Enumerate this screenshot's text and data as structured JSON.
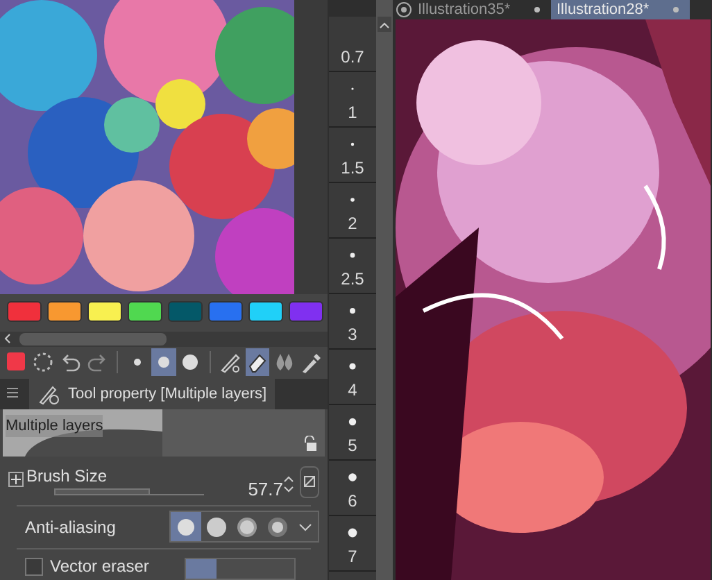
{
  "palette": {
    "swatches": [
      {
        "color": "#f0303c"
      },
      {
        "color": "#f89830"
      },
      {
        "color": "#f8f050"
      },
      {
        "color": "#50d850"
      },
      {
        "color": "#045868"
      },
      {
        "color": "#2870f0"
      },
      {
        "color": "#20d0f8"
      },
      {
        "color": "#8030f0"
      }
    ]
  },
  "toolbar": [
    {
      "kind": "color",
      "color": "#f03848",
      "selected": false
    },
    {
      "kind": "transparent",
      "selected": false
    },
    {
      "kind": "undo",
      "selected": false
    },
    {
      "kind": "redo",
      "selected": false
    },
    {
      "kind": "dot-small",
      "selected": false
    },
    {
      "kind": "dot-medium",
      "selected": true
    },
    {
      "kind": "dot-large",
      "selected": false
    },
    {
      "kind": "pen",
      "selected": false
    },
    {
      "kind": "eraser",
      "selected": true
    },
    {
      "kind": "drops",
      "selected": false
    },
    {
      "kind": "eyedropper",
      "selected": false
    }
  ],
  "tool_property": {
    "tab": "Tool property [Multiple layers]",
    "preset": "Multiple layers",
    "brush_size": {
      "label": "Brush Size",
      "value": "57.7",
      "level": 0.64
    },
    "anti_aliasing": {
      "label": "Anti-aliasing",
      "options": [
        {
          "selected": true
        },
        {
          "selected": false
        },
        {
          "selected": false
        },
        {
          "selected": false
        }
      ]
    },
    "vector_eraser": {
      "label": "Vector eraser",
      "checked": false
    }
  },
  "brush_sizes": [
    "0.7",
    "1",
    "1.5",
    "2",
    "2.5",
    "3",
    "4",
    "5",
    "6",
    "7"
  ],
  "tabs": [
    {
      "label": "Illustration35*",
      "selected": false
    },
    {
      "label": "Illustration28*",
      "selected": true
    }
  ]
}
